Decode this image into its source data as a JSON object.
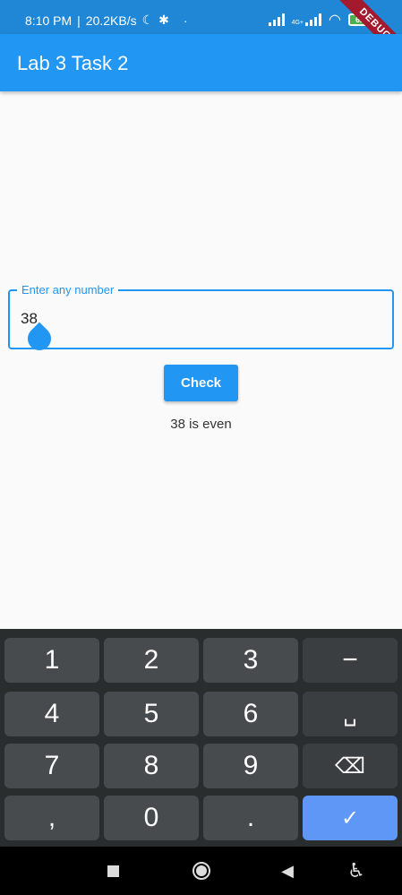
{
  "status_bar": {
    "time": "8:10 PM",
    "net_speed": "20.2KB/s",
    "network_label": "4G+",
    "battery": "62",
    "debug_banner": "DEBUG",
    "icons": [
      "moon-icon",
      "slack-icon",
      "dot-icon",
      "signal-icon",
      "signal-4g-icon",
      "wifi-icon",
      "battery-icon"
    ]
  },
  "app_bar": {
    "title": "Lab 3 Task 2"
  },
  "form": {
    "label": "Enter any number",
    "value": "38",
    "button_label": "Check",
    "result": "38 is even"
  },
  "keyboard": {
    "rows": [
      [
        "1",
        "2",
        "3",
        "−"
      ],
      [
        "4",
        "5",
        "6",
        "␣"
      ],
      [
        "7",
        "8",
        "9",
        "⌫"
      ],
      [
        ",",
        "0",
        ".",
        "✓"
      ]
    ]
  },
  "nav_bar": {
    "icons": [
      "recents-icon",
      "home-icon",
      "back-icon",
      "accessibility-icon"
    ]
  },
  "colors": {
    "primary": "#2196f3",
    "status_bar": "#1f87d6",
    "keyboard_bg": "#2a2d2e",
    "key_bg": "#484b4d",
    "done_key": "#5e97f6",
    "debug": "#a31a2e"
  }
}
